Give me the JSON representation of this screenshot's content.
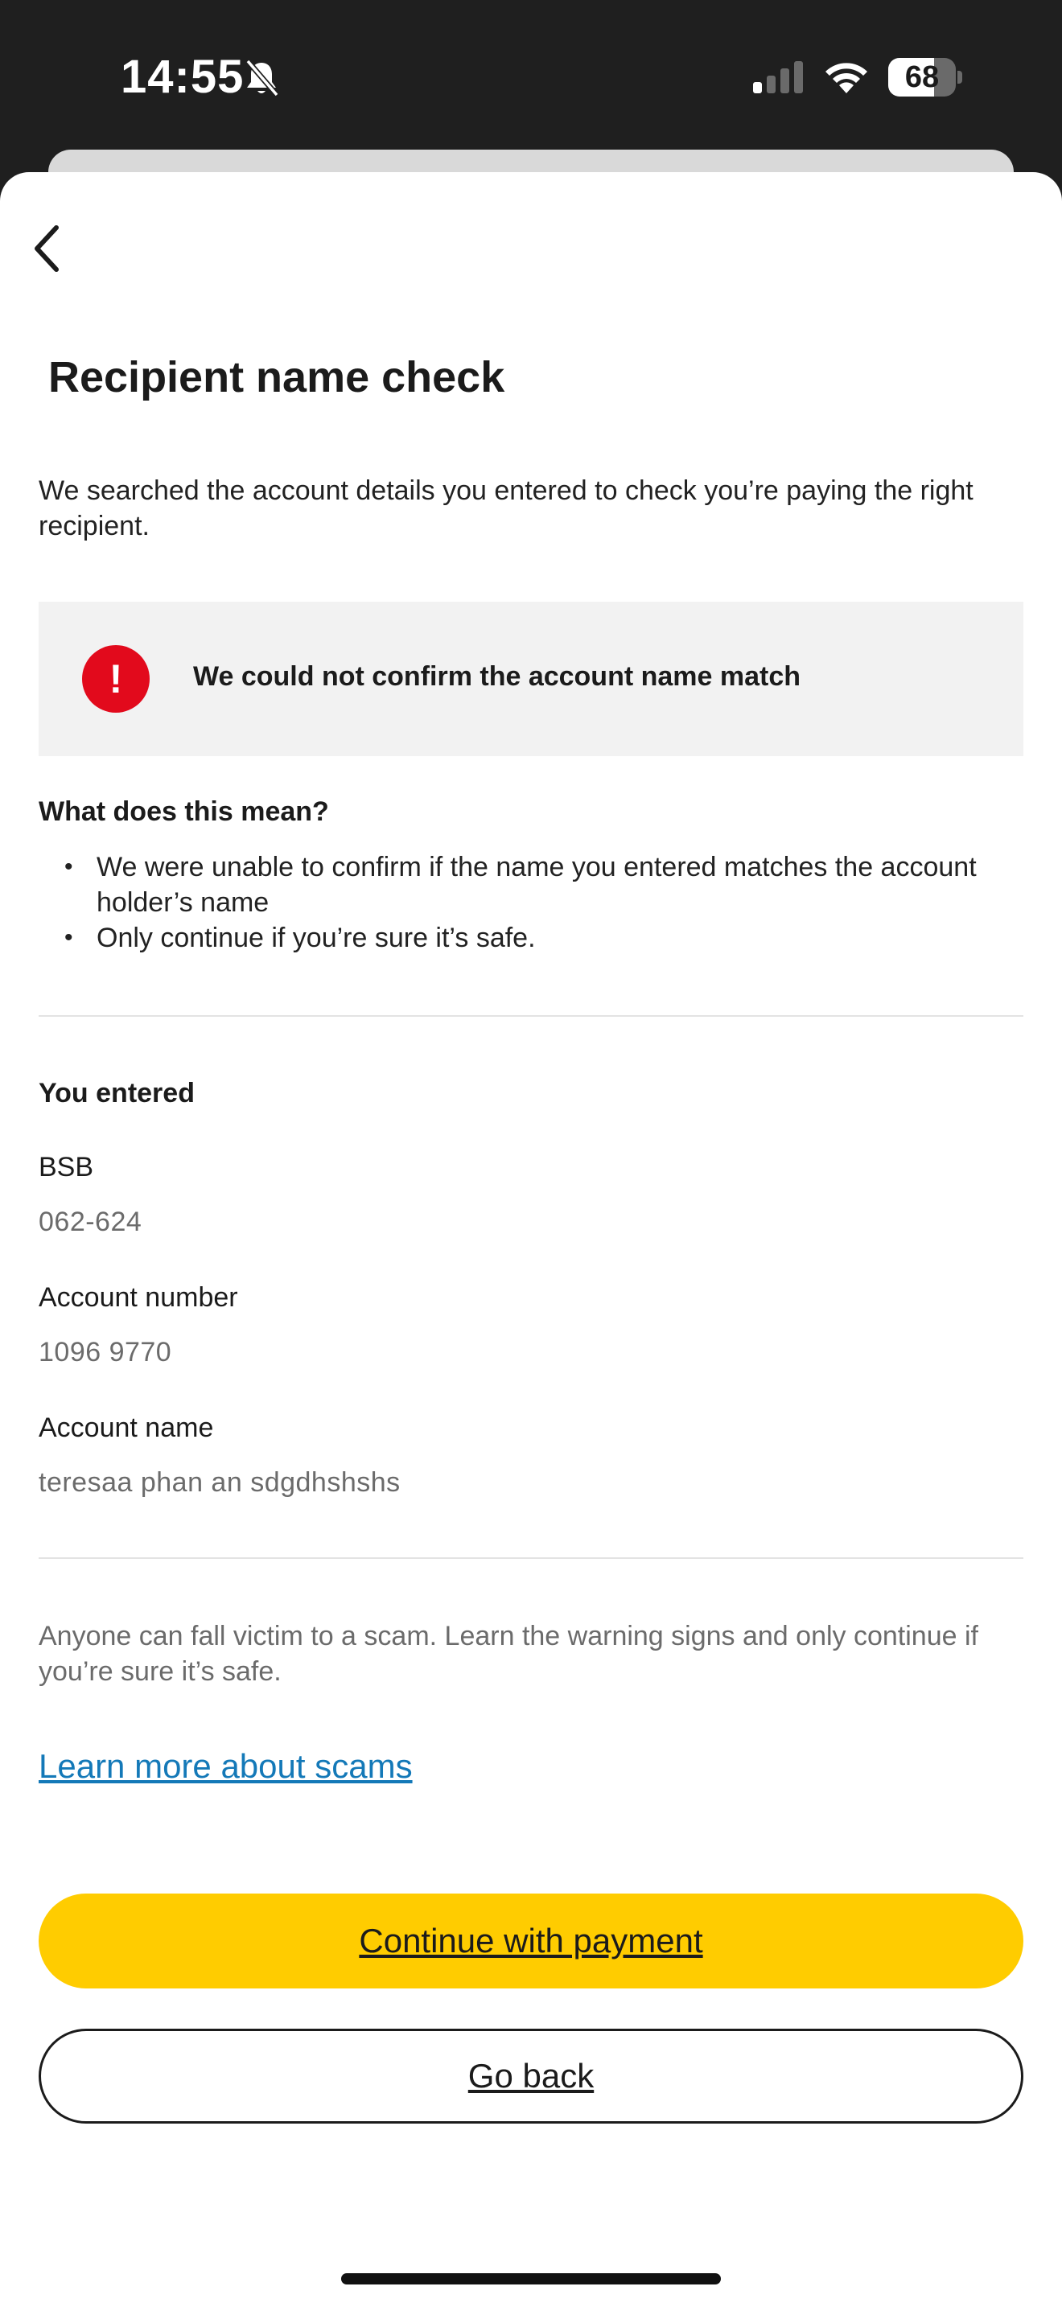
{
  "status_bar": {
    "time": "14:55",
    "battery_level": "68",
    "battery_fraction": 0.68,
    "icons": [
      "bell-slash-icon",
      "cellular-signal-icon",
      "wifi-icon",
      "battery-icon"
    ]
  },
  "header": {
    "back_icon": "chevron-left-icon",
    "title": "Recipient name check"
  },
  "intro_text": "We searched the account details you entered to check you’re paying the right recipient.",
  "alert": {
    "icon": "exclamation-icon",
    "icon_glyph": "!",
    "message": "We could not confirm the account name match",
    "colors": {
      "icon_bg": "#e20a1c",
      "panel_bg": "#f2f2f2"
    }
  },
  "meaning": {
    "title": "What does this mean?",
    "bullets": [
      "We were unable to confirm if the name you entered matches the account holder’s name",
      "Only continue if you’re sure it’s safe."
    ]
  },
  "entered": {
    "title": "You entered",
    "fields": [
      {
        "label": "BSB",
        "value": "062-624"
      },
      {
        "label": "Account number",
        "value": "1096 9770"
      },
      {
        "label": "Account name",
        "value": "teresaa phan an sdgdhshshs"
      }
    ]
  },
  "warning_text": "Anyone can fall victim to a scam. Learn the warning signs and only continue if you’re sure it’s safe.",
  "learn_more_link": "Learn more about scams",
  "buttons": {
    "continue_label": "Continue with payment",
    "go_back_label": "Go back"
  },
  "colors": {
    "accent_yellow": "#ffcc00",
    "link_blue": "#1479b8",
    "status_bar_bg": "#1f1f1f"
  }
}
